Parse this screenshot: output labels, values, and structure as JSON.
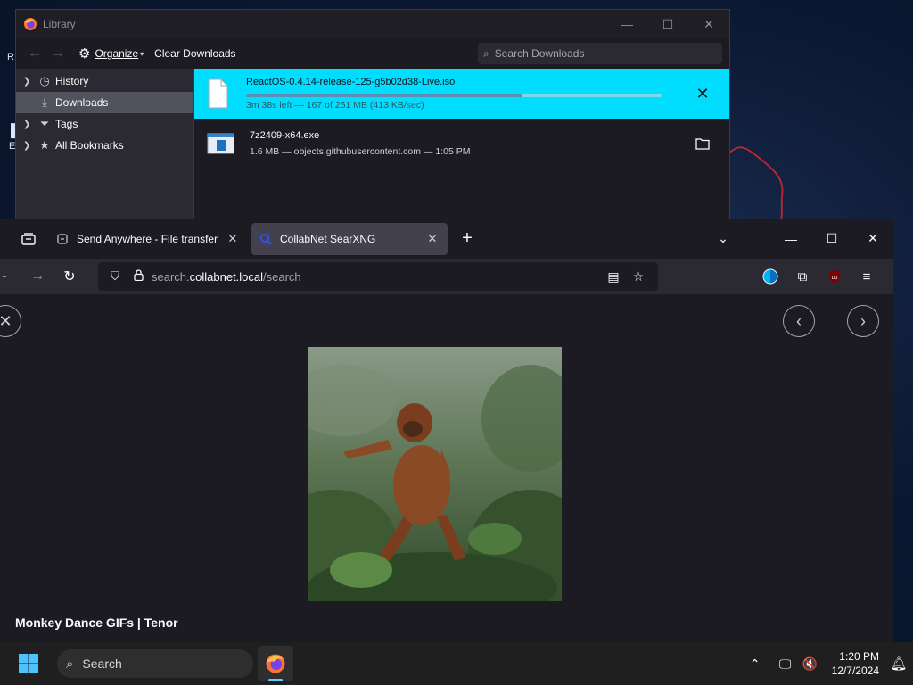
{
  "library": {
    "title": "Library",
    "toolbar": {
      "organize_label": "Organize",
      "clear_label": "Clear Downloads",
      "search_placeholder": "Search Downloads"
    },
    "sidebar": [
      {
        "label": "History",
        "icon": "clock-icon"
      },
      {
        "label": "Downloads",
        "icon": "download-icon",
        "selected": true
      },
      {
        "label": "Tags",
        "icon": "tag-icon"
      },
      {
        "label": "All Bookmarks",
        "icon": "star-icon"
      }
    ],
    "downloads": [
      {
        "name": "ReactOS-0.4.14-release-125-g5b02d38-Live.iso",
        "status": "3m 38s left — 167 of 251 MB (413 KB/sec)",
        "progress": 0.665,
        "active": true,
        "action_icon": "cancel-icon"
      },
      {
        "name": "7z2409-x64.exe",
        "status": "1.6 MB — objects.githubusercontent.com — 1:05 PM",
        "active": false,
        "action_icon": "folder-icon"
      }
    ]
  },
  "browser": {
    "tabs": [
      {
        "label": "Send Anywhere - File transfer",
        "active": false
      },
      {
        "label": "CollabNet SearXNG",
        "active": true
      }
    ],
    "url": {
      "prefix": "search.",
      "host": "collabnet.local",
      "path": "/search"
    },
    "image_caption": "Monkey Dance GIFs | Tenor"
  },
  "taskbar": {
    "search_label": "Search",
    "time": "1:20 PM",
    "date": "12/7/2024"
  },
  "colors": {
    "active_download_bg": "#00ddff",
    "active_tab_bg": "#42414d",
    "browser_bg": "#1c1b22"
  }
}
